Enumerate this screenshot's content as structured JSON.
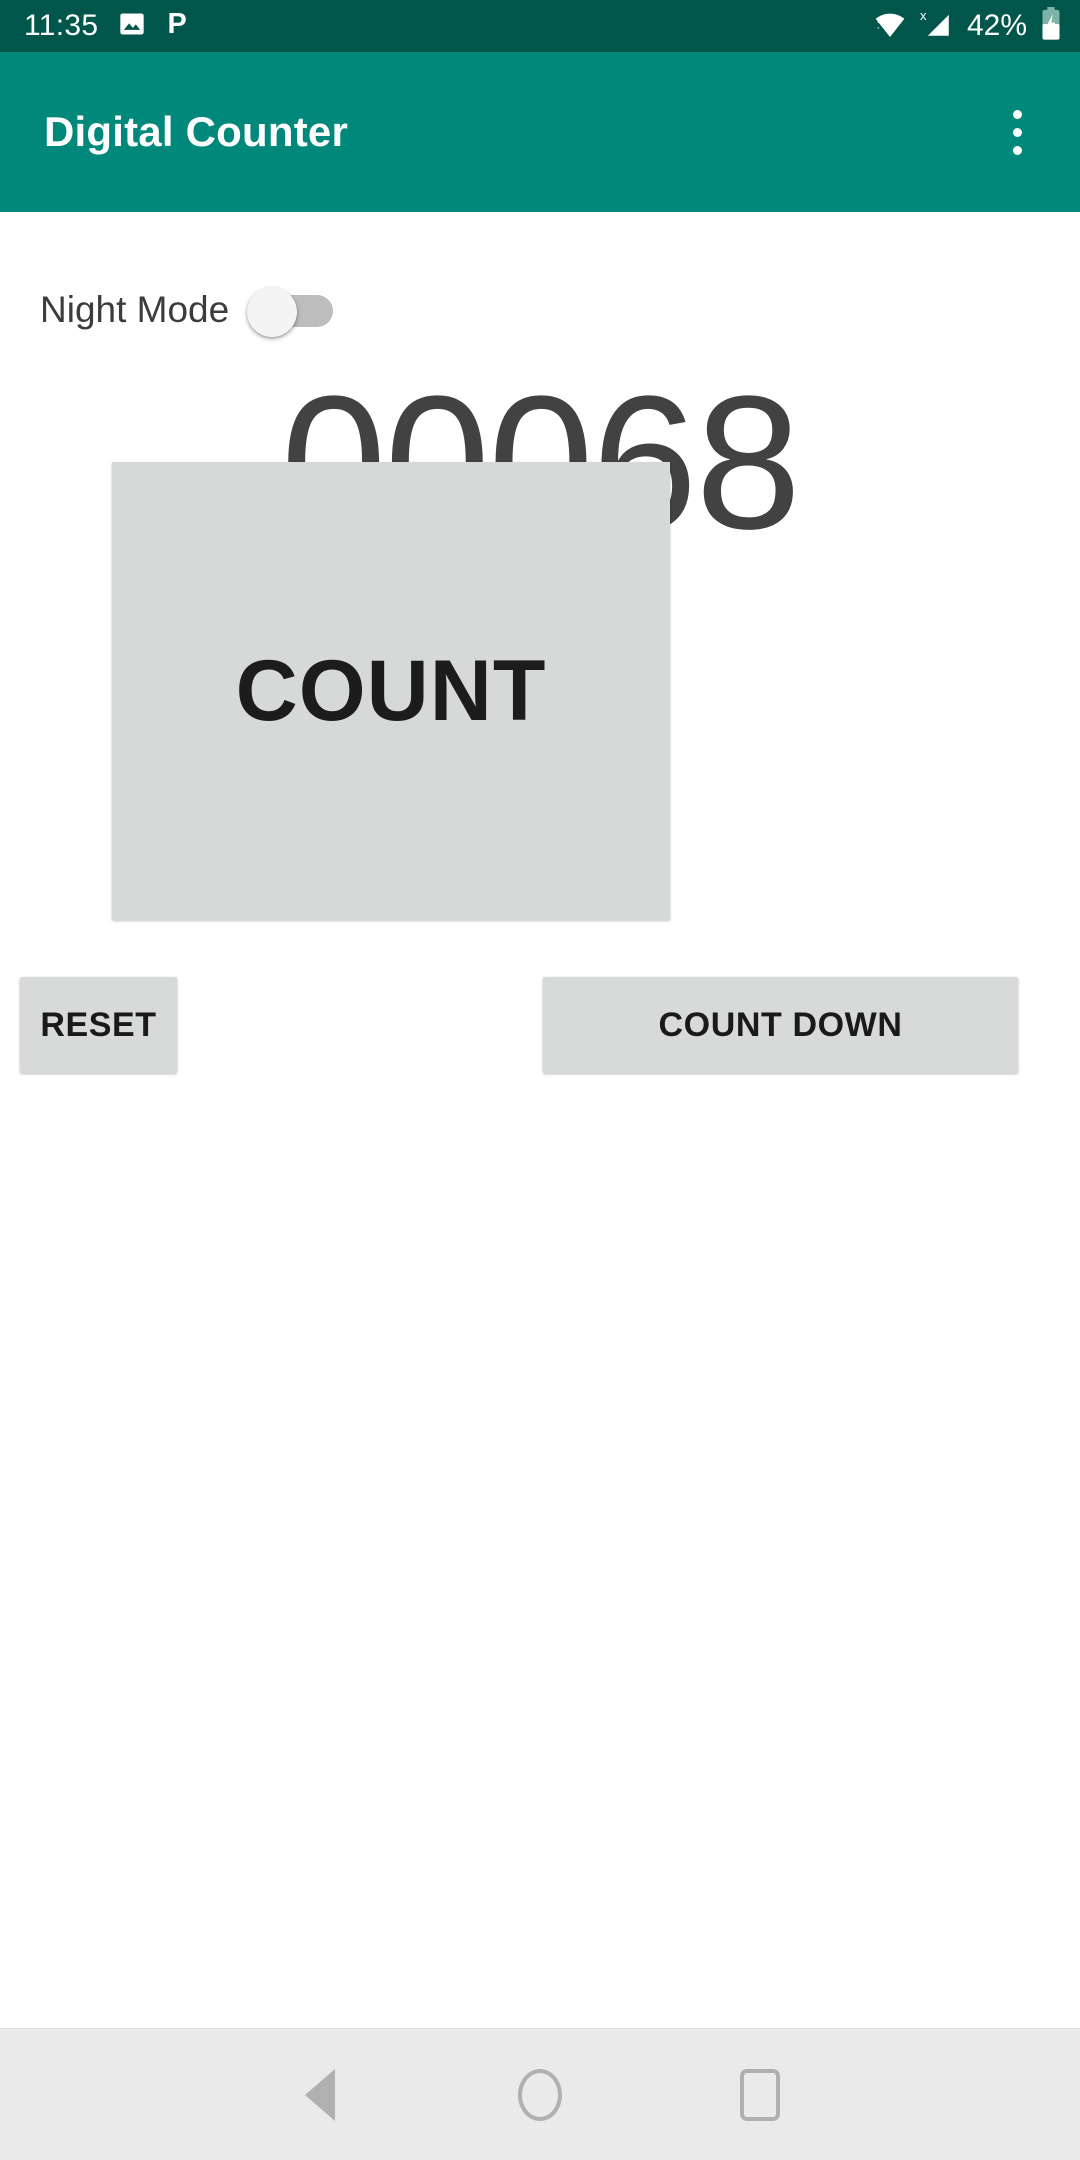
{
  "status_bar": {
    "time": "11:35",
    "battery_percent": "42%",
    "icons": {
      "photo": "image-icon",
      "pushbullet": "p-letter-icon",
      "wifi": "wifi-icon",
      "signal": "cellular-signal-no-sim-icon",
      "battery": "battery-charging-icon"
    },
    "background_color": "#00564a"
  },
  "app_bar": {
    "title": "Digital Counter",
    "overflow_menu": "overflow-menu-icon",
    "background_color": "#00897b",
    "title_color": "#ffffff"
  },
  "main": {
    "night_mode": {
      "label": "Night Mode",
      "enabled": false,
      "track_color": "#bdbdbd",
      "thumb_color": "#f4f4f4"
    },
    "counter": {
      "value": "00068",
      "digits": 5,
      "color": "#424242"
    },
    "count_button": {
      "label": "COUNT",
      "background_color": "#d6d9d8",
      "text_color": "#1c1c1c"
    },
    "actions": [
      {
        "label": "RESET",
        "name": "reset-button"
      },
      {
        "label": "COUNT DOWN",
        "name": "count-down-button"
      }
    ],
    "action_background_color": "#d7dad9",
    "background_color": "#ffffff"
  },
  "nav_bar": {
    "back": "back-triangle-icon",
    "home": "home-circle-icon",
    "recents": "recents-square-icon",
    "background_color": "#eaeaea",
    "icon_color": "#b0b0b0"
  }
}
